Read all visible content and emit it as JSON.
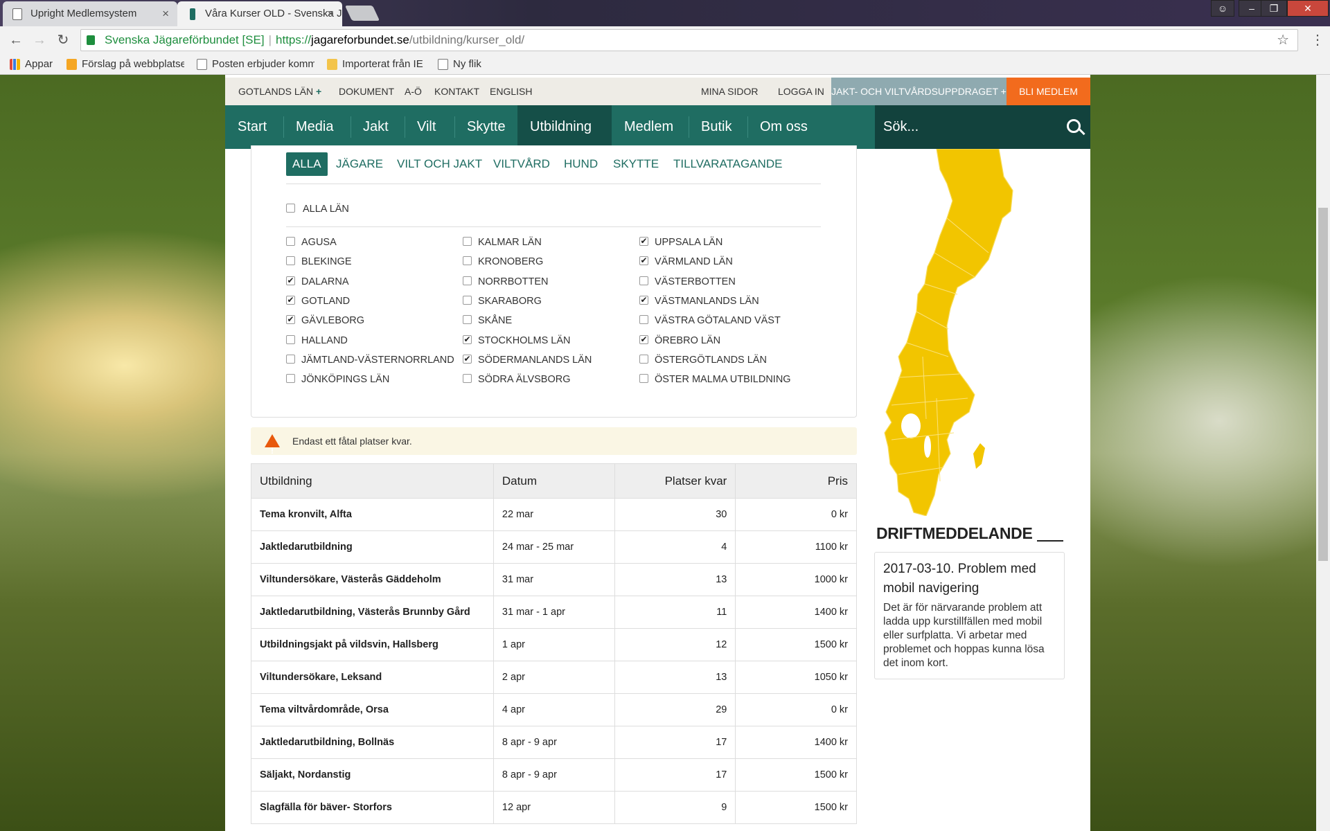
{
  "browser": {
    "tabs": [
      {
        "title": "Upright Medlemsystem"
      },
      {
        "title": "Våra Kurser OLD - Svenska Jägareförbundet"
      }
    ],
    "address": {
      "secure_label": "Svenska Jägareförbundet [SE]",
      "scheme": "https://",
      "host": "jagareforbundet.se",
      "path": "/utbildning/kurser_old/"
    },
    "bookmarks": [
      {
        "label": "Appar",
        "icon": "apps-grid-icon"
      },
      {
        "label": "Förslag på webbplatser",
        "icon": "suggested-sites-icon"
      },
      {
        "label": "Posten erbjuder komm",
        "icon": "page-icon"
      },
      {
        "label": "Importerat från IE",
        "icon": "folder-icon"
      },
      {
        "label": "Ny flik",
        "icon": "page-icon"
      }
    ]
  },
  "utility": {
    "region": "GOTLANDS LÄN",
    "links": [
      "DOKUMENT",
      "A-Ö",
      "KONTAKT",
      "ENGLISH"
    ],
    "right_links": [
      "MINA SIDOR",
      "LOGGA IN"
    ],
    "mission_button": "JAKT- OCH VILTVÅRDSUPPDRAGET",
    "member_button": "BLI MEDLEM"
  },
  "nav": {
    "items": [
      "Start",
      "Media",
      "Jakt",
      "Vilt",
      "Skytte",
      "Utbildning",
      "Medlem",
      "Butik",
      "Om oss"
    ],
    "active": "Utbildning",
    "search_placeholder": "Sök..."
  },
  "filters": {
    "categories": [
      "ALLA",
      "JÄGARE",
      "VILT OCH JAKT",
      "VILTVÅRD",
      "HUND",
      "SKYTTE",
      "TILLVARATAGANDE"
    ],
    "all_regions": {
      "label": "ALLA LÄN",
      "checked": false
    },
    "col1": [
      {
        "label": "AGUSA",
        "checked": false
      },
      {
        "label": "BLEKINGE",
        "checked": false
      },
      {
        "label": "DALARNA",
        "checked": true
      },
      {
        "label": "GOTLAND",
        "checked": true
      },
      {
        "label": "GÄVLEBORG",
        "checked": true
      },
      {
        "label": "HALLAND",
        "checked": false
      },
      {
        "label": "JÄMTLAND-VÄSTERNORRLAND",
        "checked": false
      },
      {
        "label": "JÖNKÖPINGS LÄN",
        "checked": false
      }
    ],
    "col2": [
      {
        "label": "KALMAR LÄN",
        "checked": false
      },
      {
        "label": "KRONOBERG",
        "checked": false
      },
      {
        "label": "NORRBOTTEN",
        "checked": false
      },
      {
        "label": "SKARABORG",
        "checked": false
      },
      {
        "label": "SKÅNE",
        "checked": false
      },
      {
        "label": "STOCKHOLMS LÄN",
        "checked": true
      },
      {
        "label": "SÖDERMANLANDS LÄN",
        "checked": true
      },
      {
        "label": "SÖDRA ÄLVSBORG",
        "checked": false
      }
    ],
    "col3": [
      {
        "label": "UPPSALA LÄN",
        "checked": true
      },
      {
        "label": "VÄRMLAND LÄN",
        "checked": true
      },
      {
        "label": "VÄSTERBOTTEN",
        "checked": false
      },
      {
        "label": "VÄSTMANLANDS LÄN",
        "checked": true
      },
      {
        "label": "VÄSTRA GÖTALAND VÄST",
        "checked": false
      },
      {
        "label": "ÖREBRO LÄN",
        "checked": true
      },
      {
        "label": "ÖSTERGÖTLANDS LÄN",
        "checked": false
      },
      {
        "label": "ÖSTER MALMA UTBILDNING",
        "checked": false
      }
    ]
  },
  "warning": "Endast ett fåtal platser kvar.",
  "table": {
    "headers": [
      "Utbildning",
      "Datum",
      "Platser kvar",
      "Pris"
    ],
    "rows": [
      [
        "Tema kronvilt, Alfta",
        "22 mar",
        "30",
        "0 kr"
      ],
      [
        "Jaktledarutbildning",
        "24 mar - 25 mar",
        "4",
        "1100 kr"
      ],
      [
        "Viltundersökare, Västerås Gäddeholm",
        "31 mar",
        "13",
        "1000 kr"
      ],
      [
        "Jaktledarutbildning, Västerås Brunnby Gård",
        "31 mar - 1 apr",
        "11",
        "1400 kr"
      ],
      [
        "Utbildningsjakt på vildsvin, Hallsberg",
        "1 apr",
        "12",
        "1500 kr"
      ],
      [
        "Viltundersökare, Leksand",
        "2 apr",
        "13",
        "1050 kr"
      ],
      [
        "Tema viltvårdområde, Orsa",
        "4 apr",
        "29",
        "0 kr"
      ],
      [
        "Jaktledarutbildning, Bollnäs",
        "8 apr - 9 apr",
        "17",
        "1400 kr"
      ],
      [
        "Säljakt, Nordanstig",
        "8 apr - 9 apr",
        "17",
        "1500 kr"
      ],
      [
        "Slagfälla för bäver- Storfors",
        "12 apr",
        "9",
        "1500 kr"
      ]
    ]
  },
  "sidebar": {
    "heading": "DRIFTMEDDELANDE",
    "card_title": "2017-03-10. Problem med mobil navigering",
    "card_text": "Det är för närvarande problem att ladda upp kurstillfällen  med mobil eller surfplatta. Vi arbetar med problemet och hoppas kunna lösa det inom kort."
  },
  "colors": {
    "primary_green": "#1f6d62",
    "dark_green": "#12423d",
    "orange": "#f26b1d",
    "map_yellow": "#f2c500"
  }
}
